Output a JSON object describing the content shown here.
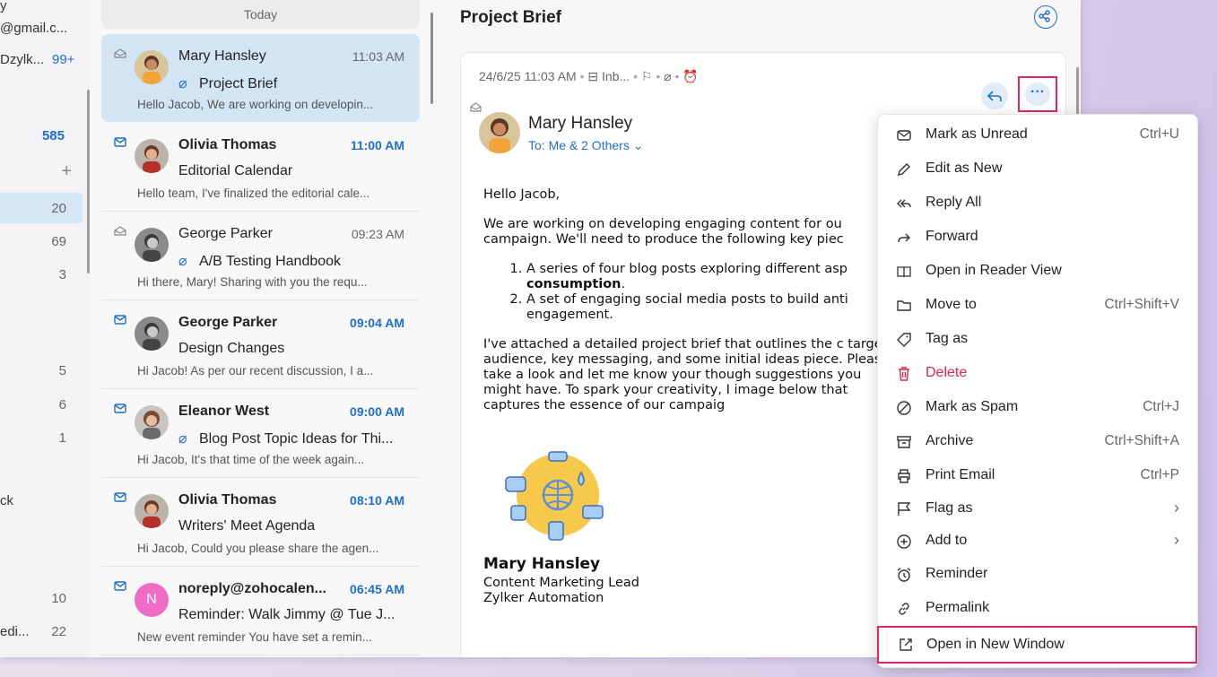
{
  "sidebar": {
    "account_email": "@gmail.c...",
    "account2_label": "Dzylk...",
    "account2_badge": "99+",
    "folders": [
      {
        "label": "",
        "count": "585"
      },
      {
        "label": "",
        "count": "+"
      },
      {
        "label": "",
        "count": "20"
      },
      {
        "label": "",
        "count": "69"
      },
      {
        "label": "",
        "count": "3"
      },
      {
        "label": "",
        "count": "5"
      },
      {
        "label": "",
        "count": "6"
      },
      {
        "label": "",
        "count": "1"
      },
      {
        "label": "ck",
        "count": ""
      },
      {
        "label": "",
        "count": "10"
      },
      {
        "label": "edi...",
        "count": "22"
      }
    ]
  },
  "list": {
    "group_label": "Today",
    "mails": [
      {
        "sender": "Mary Hansley",
        "time": "11:03 AM",
        "subject": "Project Brief",
        "preview": "Hello Jacob, We are working on developin...",
        "unread": false,
        "attachment": true
      },
      {
        "sender": "Olivia Thomas",
        "time": "11:00 AM",
        "subject": "Editorial Calendar",
        "preview": "Hello team, I've finalized the editorial cale...",
        "unread": true,
        "attachment": false
      },
      {
        "sender": "George Parker",
        "time": "09:23 AM",
        "subject": "A/B Testing Handbook",
        "preview": "Hi there, Mary! Sharing with you the requ...",
        "unread": false,
        "attachment": true
      },
      {
        "sender": "George Parker",
        "time": "09:04 AM",
        "subject": "Design Changes",
        "preview": "Hi Jacob! As per our recent discussion, I a...",
        "unread": true,
        "attachment": false
      },
      {
        "sender": "Eleanor West",
        "time": "09:00 AM",
        "subject": "Blog Post Topic Ideas for Thi...",
        "preview": "Hi Jacob, It's that time of the week again...",
        "unread": true,
        "attachment": true
      },
      {
        "sender": "Olivia Thomas",
        "time": "08:10 AM",
        "subject": "Writers' Meet Agenda",
        "preview": "Hi Jacob, Could you please share the agen...",
        "unread": true,
        "attachment": false
      },
      {
        "sender": "noreply@zohocalen...",
        "time": "06:45 AM",
        "subject": "Reminder: Walk Jimmy @ Tue J...",
        "preview": "New event reminder You have set a remin...",
        "unread": true,
        "attachment": false,
        "avatar_letter": "N"
      }
    ]
  },
  "reader": {
    "title": "Project Brief",
    "meta_date": "24/6/25 11:03 AM",
    "meta_folder": "Inb...",
    "sender": "Mary Hansley",
    "to": "To: Me & 2 Others",
    "greeting": "Hello Jacob,",
    "para1": "We are working on developing engaging content for ou campaign. We'll need to produce the following key piec",
    "item1_a": "A series of four blog posts exploring different asp",
    "item1_b": "consumption",
    "item2": "A set of engaging social media posts to build anti engagement.",
    "para2": "I've attached a detailed project brief that outlines the c target audience, key messaging, and some initial ideas piece. Please take a look and let me know your though suggestions you might have. To spark your creativity, I image below that captures the essence of our campaig",
    "sig_name": "Mary Hansley",
    "sig_title": "Content Marketing Lead",
    "sig_company": "Zylker Automation",
    "more_label": "···"
  },
  "menu": [
    {
      "icon": "envelope-icon",
      "label": "Mark as Unread",
      "shortcut": "Ctrl+U"
    },
    {
      "icon": "pencil-icon",
      "label": "Edit as New",
      "shortcut": ""
    },
    {
      "icon": "reply-all-icon",
      "label": "Reply All",
      "shortcut": ""
    },
    {
      "icon": "forward-icon",
      "label": "Forward",
      "shortcut": ""
    },
    {
      "icon": "book-icon",
      "label": "Open in Reader View",
      "shortcut": ""
    },
    {
      "icon": "folder-icon",
      "label": "Move to",
      "shortcut": "Ctrl+Shift+V"
    },
    {
      "icon": "tag-icon",
      "label": "Tag as",
      "shortcut": ""
    },
    {
      "icon": "trash-icon",
      "label": "Delete",
      "shortcut": ""
    },
    {
      "icon": "spam-icon",
      "label": "Mark as Spam",
      "shortcut": "Ctrl+J"
    },
    {
      "icon": "archive-icon",
      "label": "Archive",
      "shortcut": "Ctrl+Shift+A"
    },
    {
      "icon": "printer-icon",
      "label": "Print Email",
      "shortcut": "Ctrl+P"
    },
    {
      "icon": "flag-icon",
      "label": "Flag as",
      "shortcut": "›"
    },
    {
      "icon": "plus-circle-icon",
      "label": "Add to",
      "shortcut": "›"
    },
    {
      "icon": "alarm-icon",
      "label": "Reminder",
      "shortcut": ""
    },
    {
      "icon": "link-icon",
      "label": "Permalink",
      "shortcut": ""
    },
    {
      "icon": "external-window-icon",
      "label": "Open in New Window",
      "shortcut": ""
    }
  ],
  "colors": {
    "accent": "#1f6fd0",
    "highlight_border": "#e0285e",
    "delete": "#e0284a",
    "selected_row": "#d3e4f5"
  }
}
